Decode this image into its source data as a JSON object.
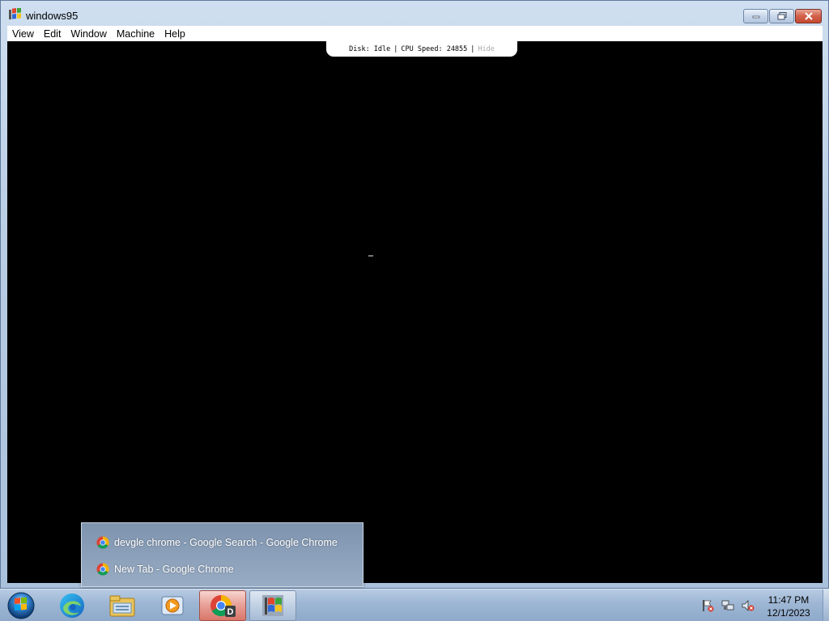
{
  "window": {
    "title": "windows95",
    "icon": "windows95-logo-icon",
    "controls": {
      "minimize_icon": "minimize-icon",
      "maximize_icon": "restore-icon",
      "close_icon": "close-icon"
    }
  },
  "menubar": {
    "items": [
      {
        "label": "View"
      },
      {
        "label": "Edit"
      },
      {
        "label": "Window"
      },
      {
        "label": "Machine"
      },
      {
        "label": "Help"
      }
    ]
  },
  "status": {
    "disk": "Disk: Idle",
    "separator": "|",
    "cpu": "CPU Speed: 24855",
    "hide": "Hide"
  },
  "jumplist": {
    "items": [
      {
        "label": "devgle chrome - Google Search - Google Chrome",
        "icon": "chrome-icon"
      },
      {
        "label": "New Tab - Google Chrome",
        "icon": "chrome-icon"
      }
    ]
  },
  "taskbar": {
    "start_icon": "windows-start-orb-icon",
    "apps": [
      {
        "name": "edge-icon"
      },
      {
        "name": "file-explorer-icon"
      },
      {
        "name": "media-player-icon"
      },
      {
        "name": "chrome-icon",
        "badge": "D",
        "state": "active"
      },
      {
        "name": "windows95-icon",
        "state": "open"
      }
    ],
    "clock": {
      "time": "11:47 PM",
      "date": "12/1/2023"
    },
    "tray_icons": [
      "action-center-flag-icon",
      "network-icon",
      "volume-muted-icon"
    ]
  },
  "colors": {
    "screen_bg": "#000000",
    "taskbar_gradient_top": "#b7cbe2",
    "active_button": "#e79e95"
  }
}
